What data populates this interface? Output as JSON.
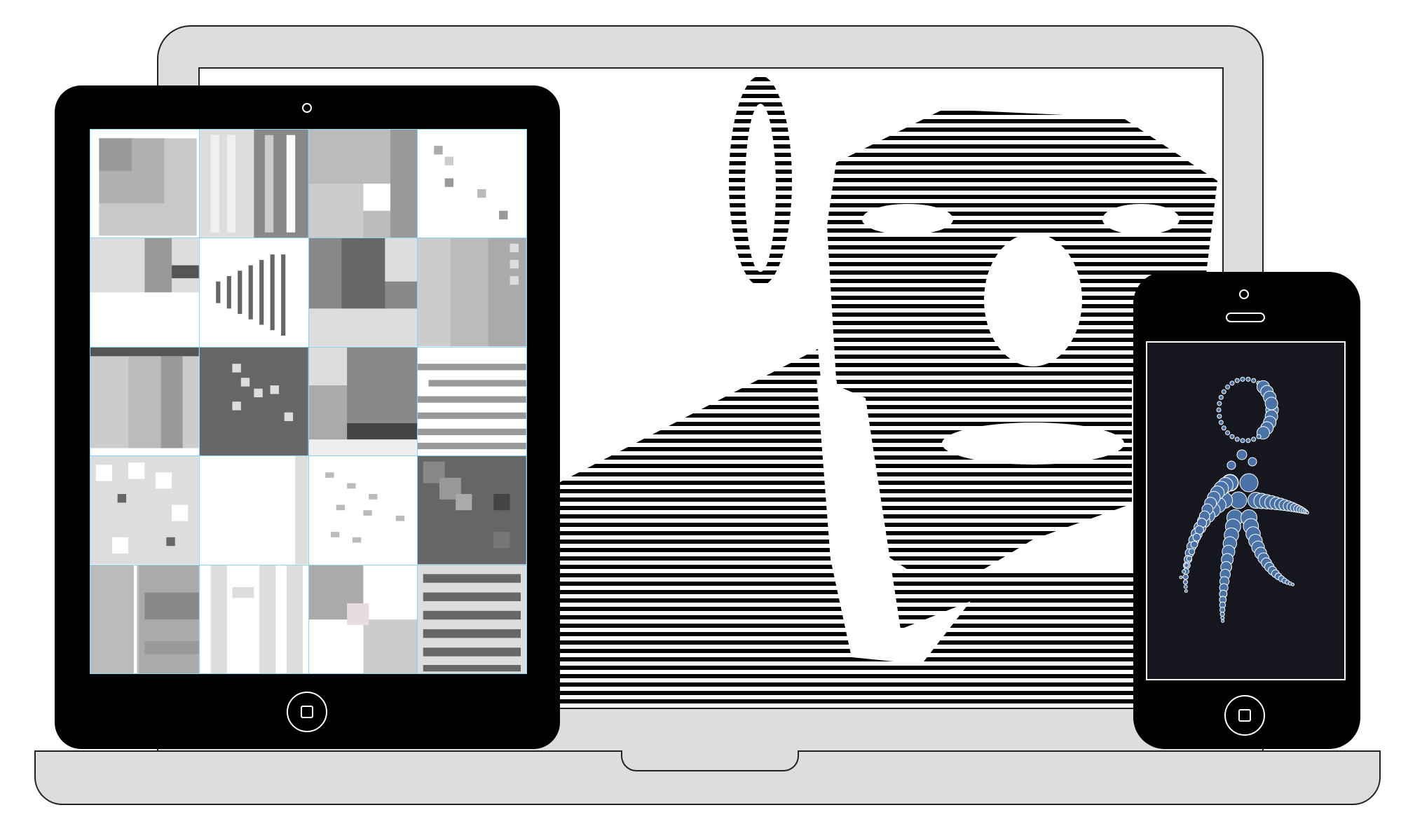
{
  "devices": {
    "laptop": {
      "body_color": "#dedcdd"
    },
    "tablet": {
      "body_color": "#000000",
      "grid_line_color": "#8fd3ee",
      "grid_columns": 4,
      "grid_rows": 5
    },
    "phone": {
      "body_color": "#000000",
      "screen_color": "#16161f",
      "circle_color": "#4a72a6"
    }
  },
  "icons": {
    "home_button": "home-button-icon",
    "camera": "camera-icon",
    "speaker": "speaker-icon"
  }
}
